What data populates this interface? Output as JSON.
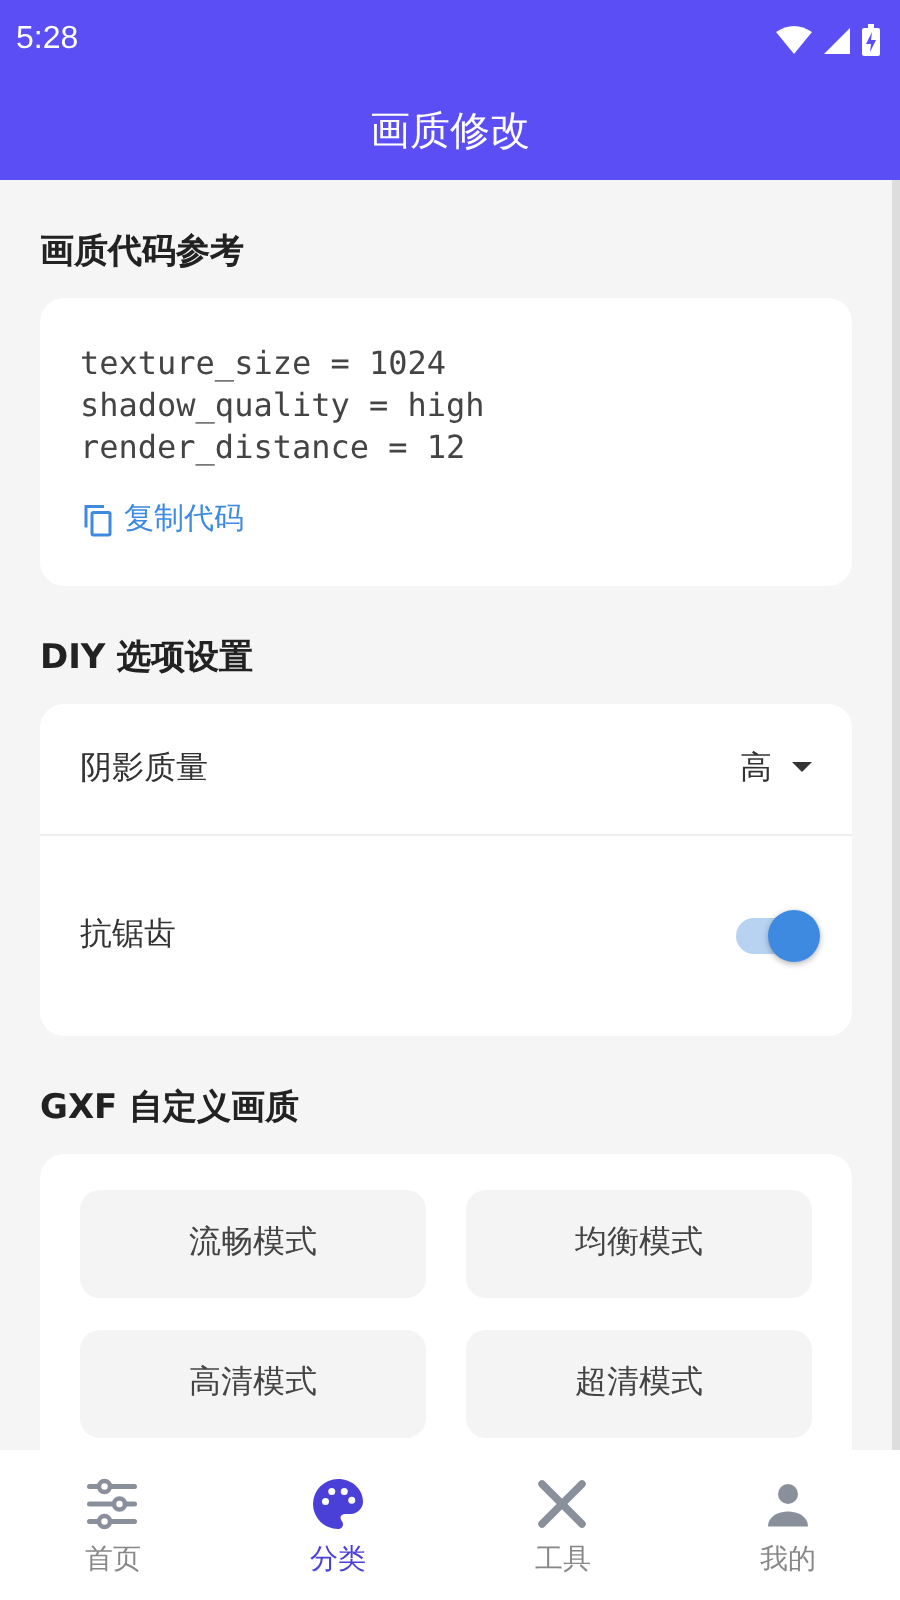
{
  "status_bar": {
    "time": "5:28"
  },
  "header": {
    "title": "画质修改"
  },
  "code_section": {
    "title": "画质代码参考",
    "lines": [
      "texture_size = 1024",
      "shadow_quality = high",
      "render_distance = 12"
    ],
    "copy_label": "复制代码"
  },
  "diy_section": {
    "title": "DIY 选项设置",
    "settings": [
      {
        "kind": "dropdown",
        "label": "阴影质量",
        "value": "高"
      },
      {
        "kind": "switch",
        "label": "抗锯齿",
        "on": true
      }
    ]
  },
  "gxf_section": {
    "title": "GXF 自定义画质",
    "modes": [
      "流畅模式",
      "均衡模式",
      "高清模式",
      "超清模式"
    ]
  },
  "bottom_nav": [
    {
      "label": "首页",
      "kind": "sliders",
      "selected": false
    },
    {
      "label": "分类",
      "kind": "palette",
      "selected": true
    },
    {
      "label": "工具",
      "kind": "tools",
      "selected": false
    },
    {
      "label": "我的",
      "kind": "person",
      "selected": false
    }
  ]
}
